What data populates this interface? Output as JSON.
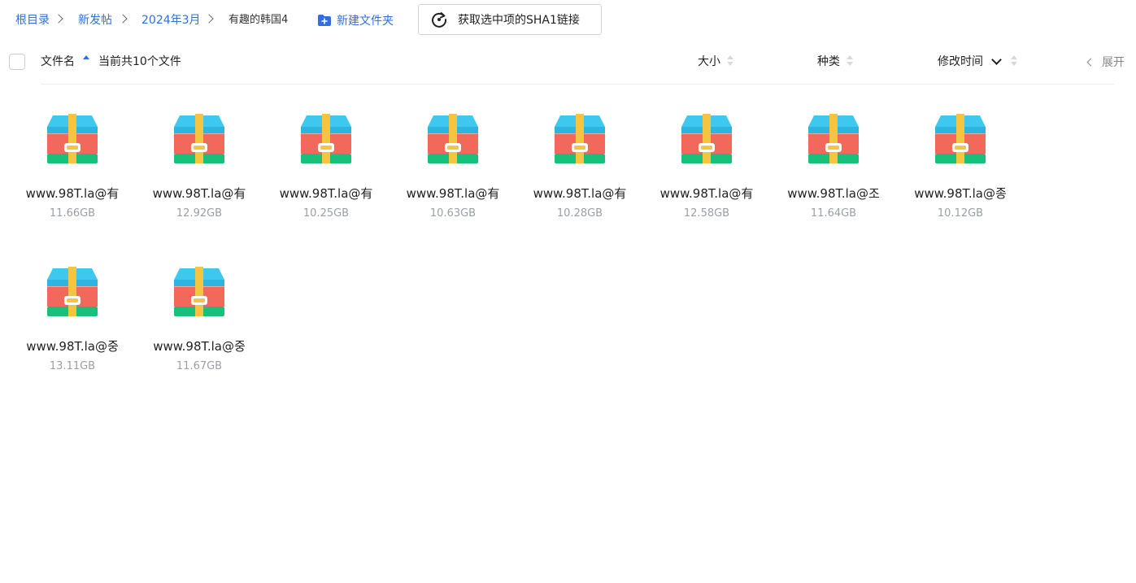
{
  "breadcrumb": {
    "items": [
      "根目录",
      "新发帖",
      "2024年3月"
    ],
    "current": "有趣的韩国4"
  },
  "toolbar": {
    "new_folder_label": "新建文件夹",
    "sha1_label": "获取选中项的SHA1链接"
  },
  "header": {
    "filename_label": "文件名",
    "file_count_label": "当前共10个文件",
    "size_label": "大小",
    "type_label": "种类",
    "modified_label": "修改时间",
    "expand_label": "展开"
  },
  "files": [
    {
      "name": "www.98T.la@有",
      "size": "11.66GB"
    },
    {
      "name": "www.98T.la@有",
      "size": "12.92GB"
    },
    {
      "name": "www.98T.la@有",
      "size": "10.25GB"
    },
    {
      "name": "www.98T.la@有",
      "size": "10.63GB"
    },
    {
      "name": "www.98T.la@有",
      "size": "10.28GB"
    },
    {
      "name": "www.98T.la@有",
      "size": "12.58GB"
    },
    {
      "name": "www.98T.la@조",
      "size": "11.64GB"
    },
    {
      "name": "www.98T.la@종",
      "size": "10.12GB"
    },
    {
      "name": "www.98T.la@중",
      "size": "13.11GB"
    },
    {
      "name": "www.98T.la@중",
      "size": "11.67GB"
    }
  ],
  "icons": {
    "file_icon": "zip-archive-icon",
    "colors": {
      "lid": "#3ec8f0",
      "lid_dark": "#2fb3e0",
      "band": "#f2695c",
      "base": "#18c07a",
      "strap": "#f5c542"
    }
  },
  "colors": {
    "link": "#2f6fe0",
    "muted": "#9aa0a8"
  }
}
